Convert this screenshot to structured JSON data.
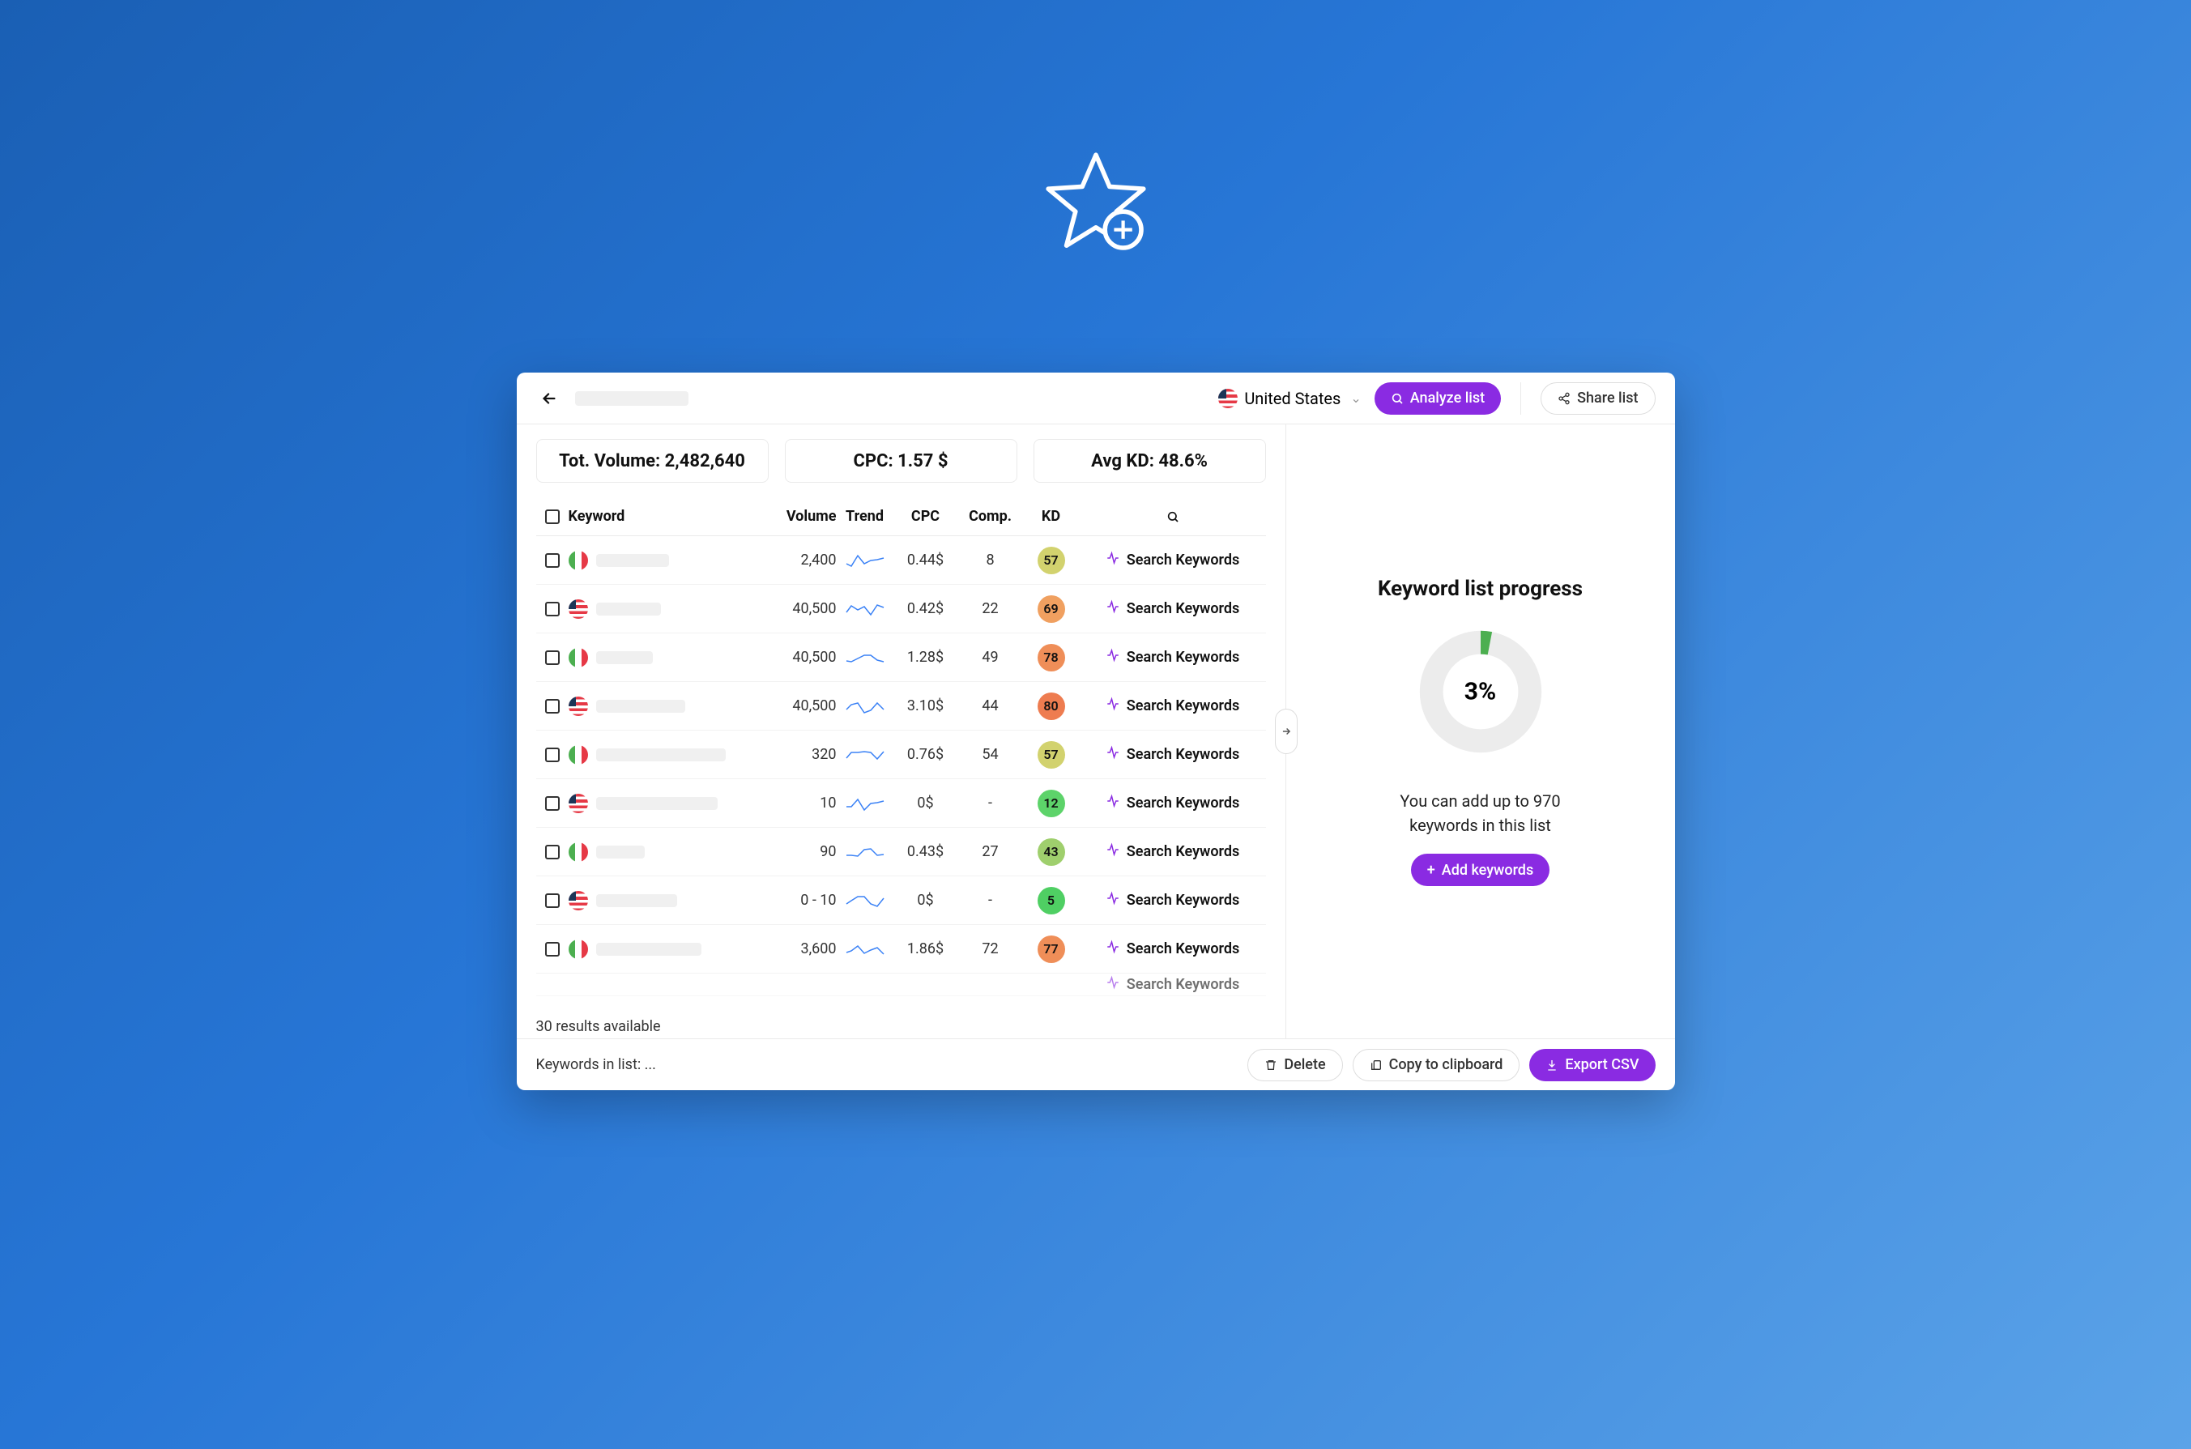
{
  "topbar": {
    "country_label": "United States",
    "analyze_label": "Analyze list",
    "share_label": "Share list"
  },
  "stats": {
    "volume": "Tot. Volume: 2,482,640",
    "cpc": "CPC: 1.57 $",
    "kd": "Avg KD: 48.6%"
  },
  "columns": {
    "keyword": "Keyword",
    "volume": "Volume",
    "trend": "Trend",
    "cpc": "CPC",
    "comp": "Comp.",
    "kd": "KD"
  },
  "rows": [
    {
      "flag": "it",
      "volume": "2,400",
      "cpc": "0.44$",
      "comp": "8",
      "kd": 57,
      "kd_color": "#d2d26e",
      "action": "Search Keywords",
      "skel_w": 90
    },
    {
      "flag": "us",
      "volume": "40,500",
      "cpc": "0.42$",
      "comp": "22",
      "kd": 69,
      "kd_color": "#f0a060",
      "action": "Search Keywords",
      "skel_w": 80
    },
    {
      "flag": "it",
      "volume": "40,500",
      "cpc": "1.28$",
      "comp": "49",
      "kd": 78,
      "kd_color": "#ef8e58",
      "action": "Search Keywords",
      "skel_w": 70
    },
    {
      "flag": "us",
      "volume": "40,500",
      "cpc": "3.10$",
      "comp": "44",
      "kd": 80,
      "kd_color": "#ee7c50",
      "action": "Search Keywords",
      "skel_w": 110
    },
    {
      "flag": "it",
      "volume": "320",
      "cpc": "0.76$",
      "comp": "54",
      "kd": 57,
      "kd_color": "#d2d26e",
      "action": "Search Keywords",
      "skel_w": 160
    },
    {
      "flag": "us",
      "volume": "10",
      "cpc": "0$",
      "comp": "-",
      "kd": 12,
      "kd_color": "#5dd36a",
      "action": "Search Keywords",
      "skel_w": 150
    },
    {
      "flag": "it",
      "volume": "90",
      "cpc": "0.43$",
      "comp": "27",
      "kd": 43,
      "kd_color": "#9fcf6d",
      "action": "Search Keywords",
      "skel_w": 60
    },
    {
      "flag": "us",
      "volume": "0 - 10",
      "cpc": "0$",
      "comp": "-",
      "kd": 5,
      "kd_color": "#4fcf63",
      "action": "Search Keywords",
      "skel_w": 100
    },
    {
      "flag": "it",
      "volume": "3,600",
      "cpc": "1.86$",
      "comp": "72",
      "kd": 77,
      "kd_color": "#ef8e58",
      "action": "Search Keywords",
      "skel_w": 130
    }
  ],
  "results_label": "30 results available",
  "peek_action": "Search Keywords",
  "right": {
    "title": "Keyword list progress",
    "percent": "3%",
    "progress_value": 3,
    "hint1": "You can add up to 970",
    "hint2": "keywords in this list",
    "add_label": "Add keywords"
  },
  "footer": {
    "keywords_in_list": "Keywords in list: ...",
    "delete": "Delete",
    "copy": "Copy to clipboard",
    "export": "Export CSV"
  }
}
